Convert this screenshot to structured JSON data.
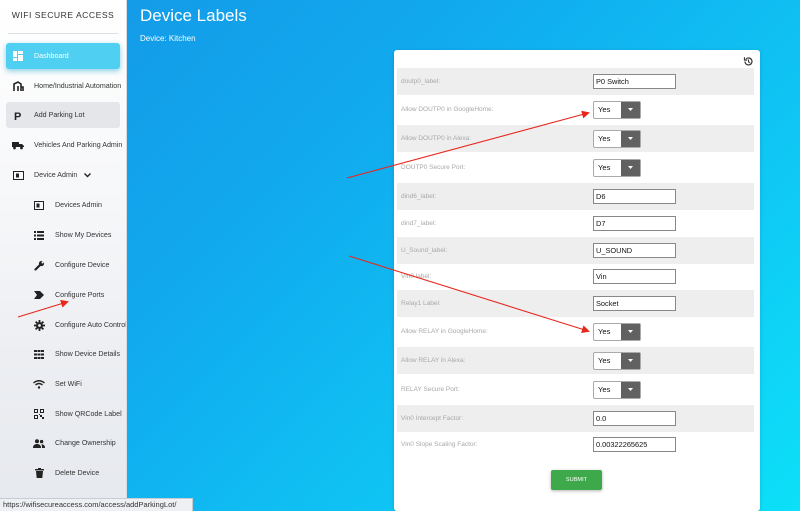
{
  "sidebar": {
    "brand": "WIFI SECURE ACCESS",
    "items": [
      {
        "label": "Dashboard",
        "icon": "dashboard-icon"
      },
      {
        "label": "Home/Industrial Automation",
        "icon": "automation-icon"
      },
      {
        "label": "Add Parking Lot",
        "icon": "parking-icon"
      },
      {
        "label": "Vehicles And Parking Admin",
        "icon": "vehicle-icon"
      },
      {
        "label": "Device Admin",
        "icon": "device-icon"
      },
      {
        "label": "Devices Admin",
        "icon": "device-card-icon"
      },
      {
        "label": "Show My Devices",
        "icon": "list-icon"
      },
      {
        "label": "Configure Device",
        "icon": "wrench-icon"
      },
      {
        "label": "Configure Ports",
        "icon": "label-arrow-icon"
      },
      {
        "label": "Configure Auto Controls",
        "icon": "gear-icon"
      },
      {
        "label": "Show Device Details",
        "icon": "grid-icon"
      },
      {
        "label": "Set WiFi",
        "icon": "wifi-icon"
      },
      {
        "label": "Show QRCode Label",
        "icon": "qrcode-icon"
      },
      {
        "label": "Change Ownership",
        "icon": "people-icon"
      },
      {
        "label": "Delete Device",
        "icon": "trash-icon"
      }
    ]
  },
  "status_url": "https://wifisecureaccess.com/access/addParkingLot/",
  "page": {
    "title": "Device Labels",
    "device_line": "Device: Kitchen"
  },
  "form": {
    "rows": [
      {
        "label": "doutp0_label:",
        "type": "text",
        "value": "P0 Switch"
      },
      {
        "label": "Allow DOUTP0 in GoogleHome:",
        "type": "select",
        "value": "Yes"
      },
      {
        "label": "Allow DOUTP0 in Alexa:",
        "type": "select",
        "value": "Yes"
      },
      {
        "label": "DOUTP0 Secure Port:",
        "type": "select",
        "value": "Yes"
      },
      {
        "label": "dind6_label:",
        "type": "text",
        "value": "D6"
      },
      {
        "label": "dind7_label:",
        "type": "text",
        "value": "D7"
      },
      {
        "label": "U_Sound_label:",
        "type": "text",
        "value": "U_SOUND"
      },
      {
        "label": "Vin0 label:",
        "type": "text",
        "value": "Vin"
      },
      {
        "label": "Relay1 Label:",
        "type": "text",
        "value": "Socket"
      },
      {
        "label": "Allow RELAY in GoogleHome:",
        "type": "select",
        "value": "Yes"
      },
      {
        "label": "Allow RELAY in Alexa:",
        "type": "select",
        "value": "Yes"
      },
      {
        "label": "RELAY Secure Port:",
        "type": "select",
        "value": "Yes"
      },
      {
        "label": "Vin0 Intercept Factor:",
        "type": "text",
        "value": "0.0"
      },
      {
        "label": "Vin0 Slope Scaling Factor:",
        "type": "text",
        "value": "0.00322265625"
      }
    ],
    "submit_label": "SUBMIT"
  },
  "colors": {
    "active_nav": "#4fd0f3",
    "submit": "#3da94a",
    "annotation_arrow": "#e8261c"
  }
}
